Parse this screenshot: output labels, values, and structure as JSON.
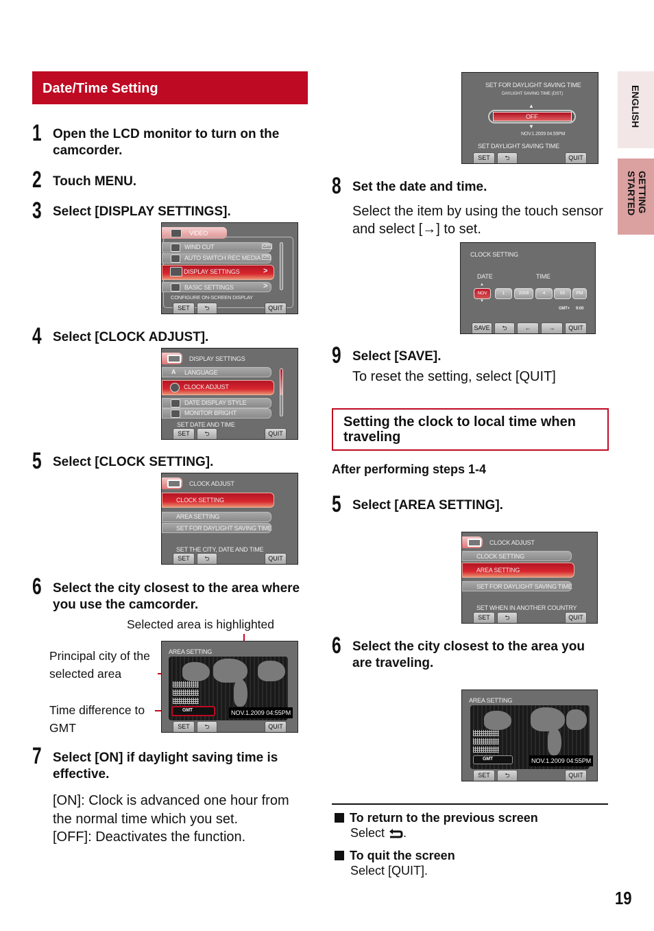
{
  "section_title": "Date/Time Setting",
  "side_tabs": {
    "language": "ENGLISH",
    "chapter": "GETTING STARTED"
  },
  "page_number": "19",
  "steps_left": [
    {
      "num": "1",
      "text": "Open the LCD monitor to turn on the camcorder."
    },
    {
      "num": "2",
      "text": "Touch MENU."
    },
    {
      "num": "3",
      "text": "Select [DISPLAY SETTINGS]."
    },
    {
      "num": "4",
      "text": "Select [CLOCK ADJUST]."
    },
    {
      "num": "5",
      "text": "Select [CLOCK SETTING]."
    },
    {
      "num": "6",
      "text": "Select the city closest to the area where you use the camcorder."
    },
    {
      "num": "7",
      "text": "Select [ON] if daylight saving time is effective.",
      "body": [
        "[ON]: Clock is advanced one hour from",
        "the normal time which you set.",
        "[OFF]: Deactivates the function."
      ]
    }
  ],
  "steps_right": [
    {
      "num": "8",
      "text": "Set the date and time.",
      "body": "Select the item by using the touch sensor and select [→] to set."
    },
    {
      "num": "9",
      "text": "Select [SAVE].",
      "body": "To reset the setting, select [QUIT]"
    }
  ],
  "travel_section": {
    "title": "Setting the clock to local time when traveling",
    "subhead": "After performing steps 1-4",
    "steps": [
      {
        "num": "5",
        "text": "Select [AREA SETTING]."
      },
      {
        "num": "6",
        "text": "Select the city closest to the area you are traveling."
      }
    ]
  },
  "callouts": {
    "highlighted": "Selected area is highlighted",
    "principal_city": "Principal city of the selected area",
    "time_diff": "Time difference to GMT"
  },
  "notes": [
    {
      "title": "To return to the previous screen",
      "body": "Select",
      "icon": "back-icon"
    },
    {
      "title": "To quit the screen",
      "body": "Select [QUIT]."
    }
  ],
  "screens": {
    "menu_video": {
      "header": "VIDEO",
      "items": [
        {
          "label": "WIND CUT",
          "value": "OFF"
        },
        {
          "label": "AUTO SWITCH REC MEDIA",
          "value": "ON"
        },
        {
          "label": "DISPLAY SETTINGS",
          "value": ">",
          "selected": true
        },
        {
          "label": "BASIC SETTINGS",
          "value": ">"
        }
      ],
      "hint": "CONFIGURE ON-SCREEN DISPLAY",
      "buttons": [
        "SET",
        "⮌",
        "QUIT"
      ]
    },
    "display_settings": {
      "header": "DISPLAY SETTINGS",
      "items": [
        {
          "label": "LANGUAGE"
        },
        {
          "label": "CLOCK ADJUST",
          "selected": true
        },
        {
          "label": "DATE DISPLAY STYLE"
        },
        {
          "label": "MONITOR BRIGHT"
        }
      ],
      "hint": "SET DATE AND TIME",
      "buttons": [
        "SET",
        "⮌",
        "QUIT"
      ]
    },
    "clock_adjust_a": {
      "header": "CLOCK ADJUST",
      "items": [
        {
          "label": "CLOCK SETTING",
          "selected": true
        },
        {
          "label": "AREA SETTING"
        },
        {
          "label": "SET FOR DAYLIGHT SAVING TIME"
        }
      ],
      "hint": "SET THE CITY, DATE AND TIME",
      "buttons": [
        "SET",
        "⮌",
        "QUIT"
      ]
    },
    "area_setting": {
      "header": "AREA SETTING",
      "gmt_label": "GMT",
      "datetime": "NOV.1.2009 04:55PM",
      "buttons": [
        "SET",
        "⮌",
        "QUIT"
      ]
    },
    "dst": {
      "title": "SET FOR DAYLIGHT SAVING TIME",
      "subtitle": "DAYLIGHT SAVING TIME (DST)",
      "value": "OFF",
      "datetime": "NOV.1.2009 04.55PM",
      "hint": "SET DAYLIGHT SAVING TIME",
      "buttons": [
        "SET",
        "⮌",
        "QUIT"
      ]
    },
    "clock_setting": {
      "title": "CLOCK SETTING",
      "date_label": "DATE",
      "time_label": "TIME",
      "fields": [
        "NOV",
        "1",
        "2009",
        "4",
        "55",
        "PM"
      ],
      "gmt": "GMT+",
      "gmt_offset": "9:00",
      "buttons": [
        "SAVE",
        "⮌",
        "←",
        "→",
        "QUIT"
      ]
    },
    "clock_adjust_b": {
      "header": "CLOCK ADJUST",
      "items": [
        {
          "label": "CLOCK SETTING"
        },
        {
          "label": "AREA SETTING",
          "selected": true
        },
        {
          "label": "SET FOR DAYLIGHT SAVING TIME"
        }
      ],
      "hint": "SET WHEN IN ANOTHER COUNTRY",
      "buttons": [
        "SET",
        "⮌",
        "QUIT"
      ]
    },
    "area_setting_b": {
      "header": "AREA SETTING",
      "gmt_label": "GMT",
      "datetime": "NOV.1.2009 04:55PM",
      "buttons": [
        "SET",
        "⮌",
        "QUIT"
      ]
    }
  }
}
